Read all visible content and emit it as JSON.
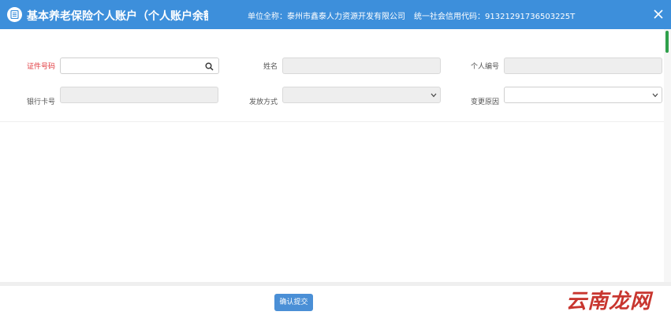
{
  "header": {
    "title": "基本养老保险个人账户（个人账户余额...",
    "unit_label": "单位全称：",
    "unit_value": "泰州市鑫泰人力资源开发有限公司",
    "credit_label": "统一社会信用代码：",
    "credit_value": "91321291736503225T"
  },
  "form": {
    "id_number": {
      "label": "证件号码",
      "value": ""
    },
    "name": {
      "label": "姓名",
      "value": ""
    },
    "personal_no": {
      "label": "个人编号",
      "value": ""
    },
    "bank_card": {
      "label": "银行卡号",
      "value": ""
    },
    "payout_method": {
      "label": "发放方式",
      "value": ""
    },
    "change_reason": {
      "label": "变更原因",
      "value": ""
    }
  },
  "footer": {
    "confirm_label": "确认提交"
  },
  "watermark": "云南龙网",
  "colors": {
    "header_bg": "#3d8fdb",
    "required_label": "#e0393e",
    "button_bg": "#4a8fd6",
    "watermark": "#c8362f"
  }
}
